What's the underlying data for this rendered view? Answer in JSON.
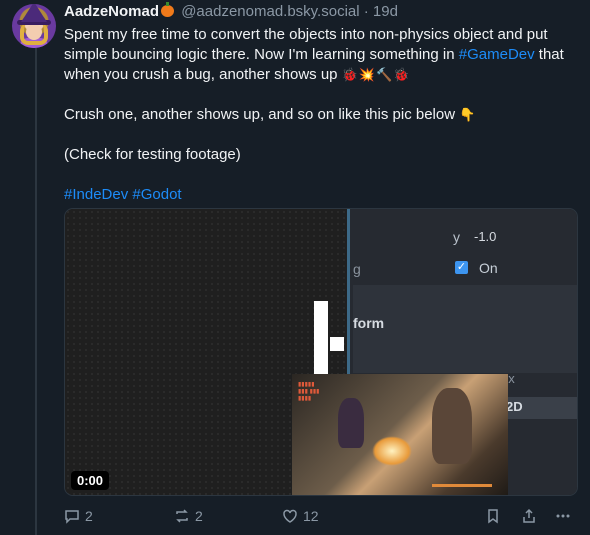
{
  "post": {
    "author": "AadzeNomad",
    "handle": "@aadzenomad.bsky.social",
    "separator": "·",
    "time": "19d",
    "text_line1": "Spent my free time to convert the objects into non-physics object and put simple bouncing logic there. Now I'm learning something in",
    "hashtag_gamedev": "#GameDev",
    "text_line1_end": " that when you crush a bug, another shows up",
    "emojis": "🐞💥🔨🐞",
    "text_line2": "Crush one, another shows up, and so on like this pic below",
    "point_down_emoji": "👇",
    "text_line3": "(Check for testing footage)",
    "hashtags": "#IndeDev #Godot"
  },
  "video": {
    "y_label": "y",
    "y_value": "-1.0",
    "g_text": "g",
    "checkbox_mark": "✓",
    "on_label": "On",
    "form_label": "form",
    "ox_label": "ox",
    "twod_label": "2D",
    "timestamp": "0:00"
  },
  "actions": {
    "replies": "2",
    "reposts": "2",
    "likes": "12"
  }
}
